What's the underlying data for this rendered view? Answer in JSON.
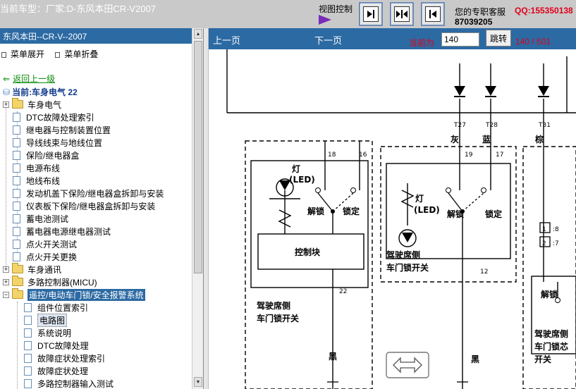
{
  "app": {
    "title": "当前车型：厂家:D-东风本田CR-V2007",
    "view_control": "视图控制",
    "support_label": "您的专职客服",
    "qq": "QQ:155350138",
    "phone": "87039205"
  },
  "sidebar": {
    "header": "东风本田--CR-V--2007",
    "expand": "菜单展开",
    "collapse": "菜单折叠",
    "back": "返回上一级",
    "current": "当前:车身电气 22",
    "tree": [
      {
        "label": "车身电气",
        "type": "folder"
      },
      {
        "label": "DTC故障处理索引",
        "type": "doc"
      },
      {
        "label": "继电器与控制装置位置",
        "type": "doc"
      },
      {
        "label": "导线线束与地线位置",
        "type": "doc"
      },
      {
        "label": "保险/继电器盒",
        "type": "doc"
      },
      {
        "label": "电源布线",
        "type": "doc"
      },
      {
        "label": "地线布线",
        "type": "doc"
      },
      {
        "label": "发动机盖下保险/继电器盒拆卸与安装",
        "type": "doc"
      },
      {
        "label": "仪表板下保险/继电器盒拆卸与安装",
        "type": "doc"
      },
      {
        "label": "蓄电池测试",
        "type": "doc"
      },
      {
        "label": "蓄电器电源继电器测试",
        "type": "doc"
      },
      {
        "label": "点火开关测试",
        "type": "doc"
      },
      {
        "label": "点火开关更换",
        "type": "doc"
      },
      {
        "label": "车身通讯",
        "type": "folder"
      },
      {
        "label": "多路控制器(MICU)",
        "type": "folder"
      },
      {
        "label": "遥控/电动车门锁/安全报警系统",
        "type": "folder-open"
      },
      {
        "label": "组件位置索引",
        "type": "doc"
      },
      {
        "label": "电路图",
        "type": "doc"
      },
      {
        "label": "系统说明",
        "type": "doc"
      },
      {
        "label": "DTC故障处理",
        "type": "doc"
      },
      {
        "label": "故障症状处理索引",
        "type": "doc"
      },
      {
        "label": "故障症状处理",
        "type": "doc"
      },
      {
        "label": "多路控制器输入测试",
        "type": "doc"
      }
    ]
  },
  "toolbar": {
    "prev": "上一页",
    "next": "下一页",
    "current_label": "当前为",
    "page_value": "140",
    "go": "跳转",
    "page_count": "140 / 501"
  },
  "diagram": {
    "pins": [
      "T27",
      "T28",
      "T31"
    ],
    "wire_colors": [
      "灰",
      "蓝",
      "棕",
      "黑",
      "黑"
    ],
    "pin_numbers": [
      "18",
      "16",
      "19",
      "17",
      "12",
      "22"
    ],
    "lamp_led_1": "灯",
    "led_1": "(LED)",
    "lamp_led_2": "灯",
    "led_2": "(LED)",
    "unlock_1": "解锁",
    "lock_1": "锁定",
    "unlock_2": "解锁",
    "lock_2": "锁定",
    "unlock_3": "解锁",
    "control_block": "控制块",
    "switch_1": "驾驶席侧",
    "switch_1b": "车门锁开关",
    "switch_2": "驾驶席侧",
    "switch_2b": "车门锁开关",
    "switch_3": "驾驶席侧",
    "switch_3b": "车门锁芯",
    "switch_3c": "开关",
    "conn_a": "1",
    "conn_a_pin": ":8",
    "conn_b": "2",
    "conn_b_pin": ":7"
  }
}
